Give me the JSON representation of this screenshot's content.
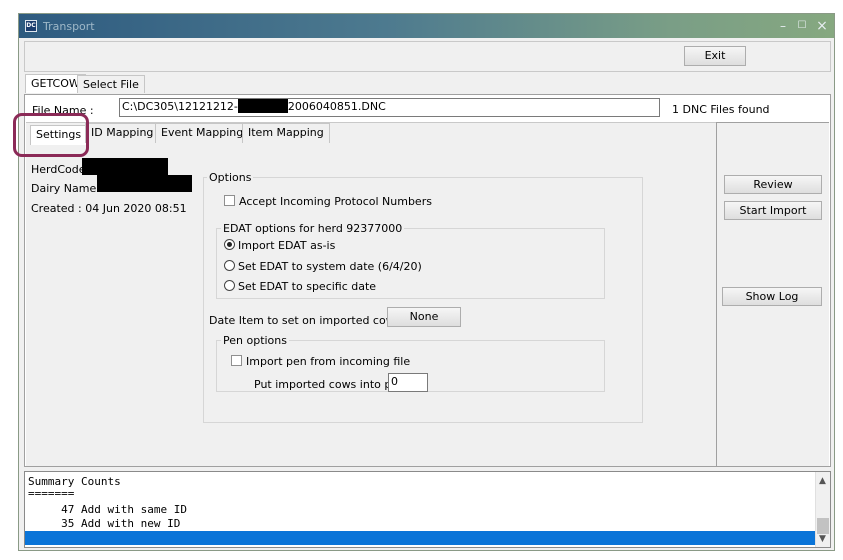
{
  "window": {
    "title": "Transport",
    "icon_text": "DC",
    "controls": {
      "minimize": "–",
      "maximize": "☐",
      "close": "×"
    }
  },
  "toolbar": {
    "exit_label": "Exit"
  },
  "top_tabs": [
    {
      "label": "GETCOW",
      "active": true
    },
    {
      "label": "Select File",
      "active": false
    }
  ],
  "file": {
    "label": "File Name :",
    "value_prefix": "C:\\DC305\\12121212-",
    "value_suffix": "2006040851.DNC",
    "status": "1 DNC Files found"
  },
  "inner_tabs": [
    {
      "label": "Settings",
      "active": true
    },
    {
      "label": "ID Mapping",
      "active": false
    },
    {
      "label": "Event Mapping",
      "active": false
    },
    {
      "label": "Item Mapping",
      "active": false
    }
  ],
  "herd_info": {
    "herdcode_label": "HerdCode",
    "dairy_name_label": "Dairy Name :",
    "created": "Created : 04 Jun 2020 08:51"
  },
  "options": {
    "legend": "Options",
    "accept_protocol_label": "Accept Incoming Protocol Numbers",
    "accept_protocol_checked": false,
    "edat": {
      "legend": "EDAT options for herd 92377000",
      "choices": [
        {
          "label": "Import EDAT as-is",
          "selected": true
        },
        {
          "label": "Set EDAT to system date (6/4/20)",
          "selected": false
        },
        {
          "label": "Set EDAT to specific date",
          "selected": false
        }
      ]
    },
    "date_item_label": "Date Item to set on imported cows",
    "date_item_button": "None",
    "pen": {
      "legend": "Pen options",
      "import_pen_label": "Import pen from incoming file",
      "import_pen_checked": false,
      "put_into_pen_label": "Put imported cows into pen",
      "pen_value": "0"
    }
  },
  "actions": {
    "review": "Review",
    "start_import": "Start Import",
    "show_log": "Show Log"
  },
  "summary": {
    "lines": [
      "Summary Counts",
      "=======",
      "     47 Add with same ID",
      "     35 Add with new ID"
    ]
  },
  "colors": {
    "highlight": "#0a74d8",
    "settings_tab_callout": "#8b2a57"
  }
}
